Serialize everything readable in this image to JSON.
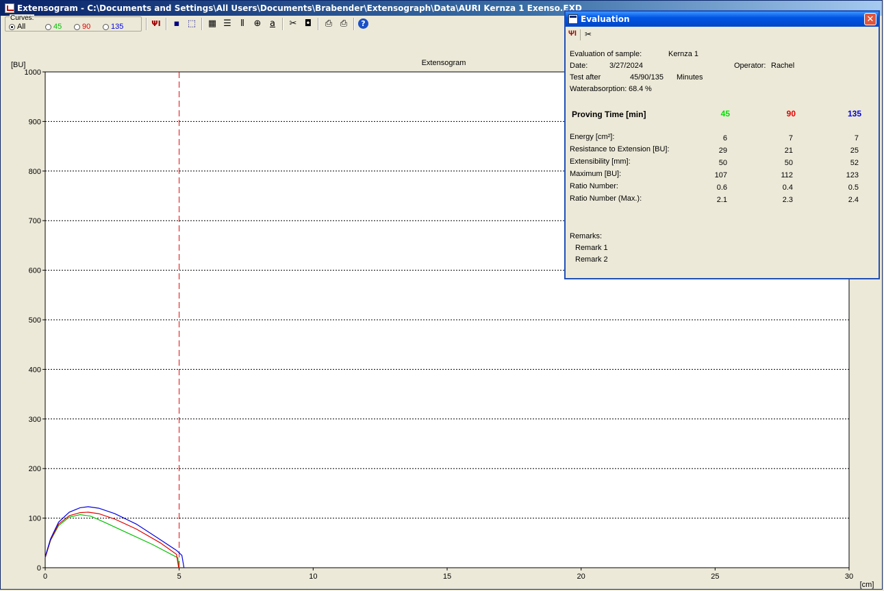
{
  "window": {
    "title": "Extensogram - C:\\Documents and Settings\\All Users\\Documents\\Brabender\\Extensograph\\Data\\AURI Kernza 1 Exenso.EXD"
  },
  "toolbar": {
    "curves_label": "Curves:",
    "options": [
      {
        "label": "All",
        "color": "#000000",
        "selected": true
      },
      {
        "label": "45",
        "color": "#00c000",
        "selected": false
      },
      {
        "label": "90",
        "color": "#e00000",
        "selected": false
      },
      {
        "label": "135",
        "color": "#0000e0",
        "selected": false
      }
    ],
    "icons": [
      "proving-icon",
      "save-icon",
      "export-icon",
      "data-table-icon",
      "horizontal-grid-icon",
      "vertical-grid-icon",
      "zoom-icon",
      "text-label-icon",
      "cut-icon",
      "camera-icon",
      "print-preview-icon",
      "print-icon",
      "help-icon"
    ],
    "glyphs": {
      "proving": "ΨΙ",
      "save": "▪",
      "export": "⬚",
      "data": "▦",
      "hgrid": "☰",
      "vgrid": "⦀",
      "zoom": "⊕",
      "label": "a",
      "cut": "✂",
      "camera": "◘",
      "preview": "⎙",
      "print": "⎙",
      "help": "?"
    }
  },
  "chart_data": {
    "type": "line",
    "title": "Extensogram",
    "ylabel": "[BU]",
    "xlabel": "[cm]",
    "xlim": [
      0,
      30
    ],
    "ylim": [
      0,
      1000
    ],
    "x_ticks": [
      0,
      5,
      10,
      15,
      20,
      25,
      30
    ],
    "y_ticks": [
      0,
      100,
      200,
      300,
      400,
      500,
      600,
      700,
      800,
      900,
      1000
    ],
    "grid": "horizontal dotted",
    "marker_line_x": 5,
    "series": [
      {
        "name": "45",
        "color": "#00c000",
        "x": [
          0,
          0.2,
          0.5,
          0.9,
          1.3,
          1.7,
          2.2,
          3.0,
          4.0,
          4.95,
          4.98
        ],
        "y": [
          20,
          55,
          85,
          102,
          107,
          104,
          92,
          72,
          47,
          20,
          0
        ]
      },
      {
        "name": "90",
        "color": "#e00000",
        "x": [
          0,
          0.2,
          0.5,
          0.9,
          1.3,
          1.6,
          2.0,
          2.6,
          3.4,
          4.3,
          4.9,
          4.98
        ],
        "y": [
          20,
          56,
          88,
          105,
          111,
          112,
          109,
          98,
          78,
          50,
          27,
          0
        ]
      },
      {
        "name": "135",
        "color": "#0000e0",
        "x": [
          0,
          0.2,
          0.5,
          0.9,
          1.3,
          1.6,
          2.0,
          2.6,
          3.4,
          4.2,
          4.9,
          5.1,
          5.18
        ],
        "y": [
          22,
          58,
          92,
          112,
          121,
          123,
          120,
          109,
          88,
          60,
          35,
          25,
          0
        ]
      }
    ]
  },
  "evaluation": {
    "title": "Evaluation",
    "close_glyph": "✕",
    "toolbar_glyphs": {
      "proving": "ΨΙ",
      "cut": "✂"
    },
    "sample_label": "Evaluation of sample:",
    "sample_value": "Kernza 1",
    "date_label": "Date:",
    "date_value": "3/27/2024",
    "operator_label": "Operator:",
    "operator_value": "Rachel",
    "test_after_label": "Test after",
    "test_after_value": "45/90/135",
    "test_after_unit": "Minutes",
    "waterabsorption_label": "Waterabsorption:",
    "waterabsorption_value": "68.4",
    "waterabsorption_unit": "%",
    "proving_time_label": "Proving Time [min]",
    "columns": [
      {
        "label": "45",
        "color": "#00e000"
      },
      {
        "label": "90",
        "color": "#e00000"
      },
      {
        "label": "135",
        "color": "#0000e0"
      }
    ],
    "rows": [
      {
        "label": "Energy [cm²]:",
        "values": [
          "6",
          "7",
          "7"
        ]
      },
      {
        "label": "Resistance to Extension [BU]:",
        "values": [
          "29",
          "21",
          "25"
        ]
      },
      {
        "label": "Extensibility [mm]:",
        "values": [
          "50",
          "50",
          "52"
        ]
      },
      {
        "label": "Maximum [BU]:",
        "values": [
          "107",
          "112",
          "123"
        ]
      },
      {
        "label": "Ratio Number:",
        "values": [
          "0.6",
          "0.4",
          "0.5"
        ]
      },
      {
        "label": "Ratio Number (Max.):",
        "values": [
          "2.1",
          "2.3",
          "2.4"
        ]
      }
    ],
    "remarks_label": "Remarks:",
    "remarks": [
      "Remark 1",
      "Remark 2"
    ]
  }
}
